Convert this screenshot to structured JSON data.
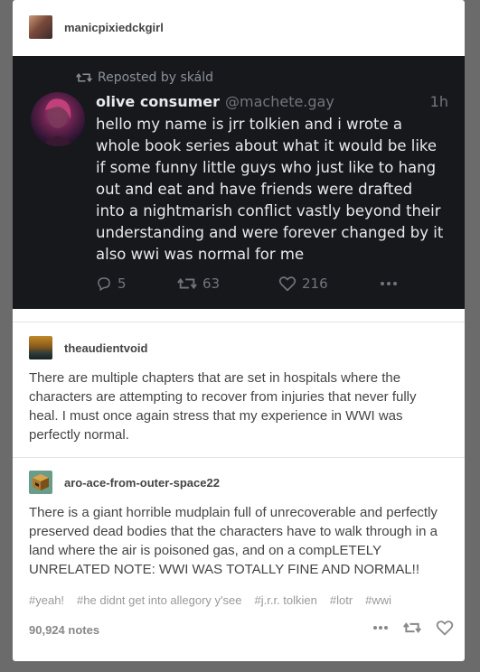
{
  "post": {
    "op_username": "manicpixiedckgirl",
    "tweet": {
      "repost_label": "Reposted by skáld",
      "display_name": "olive consumer",
      "handle": "@machete.gay",
      "time": "1h",
      "text": "hello my name is jrr tolkien and i wrote a whole book series about what it would be like if some funny little guys who just like to hang out and eat and have friends were drafted into a nightmarish conflict vastly beyond their understanding and were forever changed by it also wwi was normal for me",
      "replies": "5",
      "reposts": "63",
      "likes": "216"
    },
    "reblogs": [
      {
        "username": "theaudientvoid",
        "text": "There are multiple chapters that are set in hospitals where the characters are attempting to recover from injuries that never fully heal. I must once again stress that my experience in WWI was perfectly normal."
      },
      {
        "username": "aro-ace-from-outer-space22",
        "text": "There is a giant horrible mudplain full of unrecoverable and perfectly preserved dead bodies that the characters have to walk through in a land where the air is poisoned gas, and on a compLETELY UNRELATED NOTE: WWI WAS TOTALLY FINE AND NORMAL!!"
      }
    ],
    "tags": [
      "#yeah!",
      "#he didnt get into allegory y'see",
      "#j.r.r. tolkien",
      "#lotr",
      "#wwi"
    ],
    "notes": "90,924 notes"
  },
  "colors": {
    "page_bg": "#6b6b6b",
    "tweet_bg": "#16181c",
    "tweet_text": "#e7e9ea",
    "tweet_muted": "#71767b"
  },
  "icons": [
    "avatar-op",
    "repost-icon",
    "reply-icon",
    "retweet-icon",
    "like-icon",
    "more-icon",
    "avatar-painting",
    "avatar-cube",
    "reblog-icon",
    "heart-icon"
  ]
}
